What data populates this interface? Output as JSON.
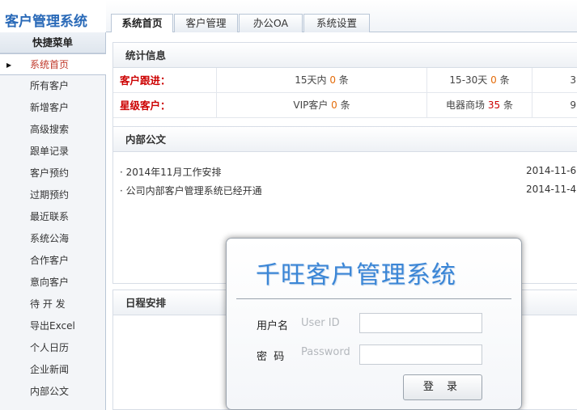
{
  "app": {
    "title": "客户管理系统"
  },
  "tabs": [
    {
      "label": "系统首页"
    },
    {
      "label": "客户管理"
    },
    {
      "label": "办公OA"
    },
    {
      "label": "系统设置"
    }
  ],
  "sidebar": {
    "header": "快捷菜单",
    "items": [
      {
        "label": "系统首页"
      },
      {
        "label": "所有客户"
      },
      {
        "label": "新增客户"
      },
      {
        "label": "高级搜索"
      },
      {
        "label": "跟单记录"
      },
      {
        "label": "客户预约"
      },
      {
        "label": "过期预约"
      },
      {
        "label": "最近联系"
      },
      {
        "label": "系统公海"
      },
      {
        "label": "合作客户"
      },
      {
        "label": "意向客户"
      },
      {
        "label": "待 开 发"
      },
      {
        "label": "导出Excel"
      },
      {
        "label": "个人日历"
      },
      {
        "label": "企业新闻"
      },
      {
        "label": "内部公文"
      }
    ]
  },
  "stats": {
    "title": "统计信息",
    "rows": [
      {
        "label": "客户跟进：",
        "c1_pre": "15天内 ",
        "c1_num": "0",
        "c1_post": " 条",
        "c2_pre": "15-30天 ",
        "c2_num": "0",
        "c2_post": " 条",
        "c3_pre": "3"
      },
      {
        "label": "星级客户：",
        "c1_pre": "VIP客户 ",
        "c1_num": "0",
        "c1_post": " 条",
        "c2_pre": "电器商场 ",
        "c2_num": "35",
        "c2_post": " 条",
        "c3_pre": "9"
      }
    ]
  },
  "notices": {
    "title": "内部公文",
    "items": [
      {
        "text": "· 2014年11月工作安排",
        "date": "2014-11-6"
      },
      {
        "text": "· 公司内部客户管理系统已经开通",
        "date": "2014-11-4"
      }
    ]
  },
  "schedule": {
    "title": "日程安排"
  },
  "login": {
    "title": "千旺客户管理系统",
    "user_label": "用户名",
    "user_hint": "User ID",
    "user_value": "",
    "pwd_label": "密  码",
    "pwd_hint": "Password",
    "pwd_value": "",
    "submit": "登 录"
  }
}
